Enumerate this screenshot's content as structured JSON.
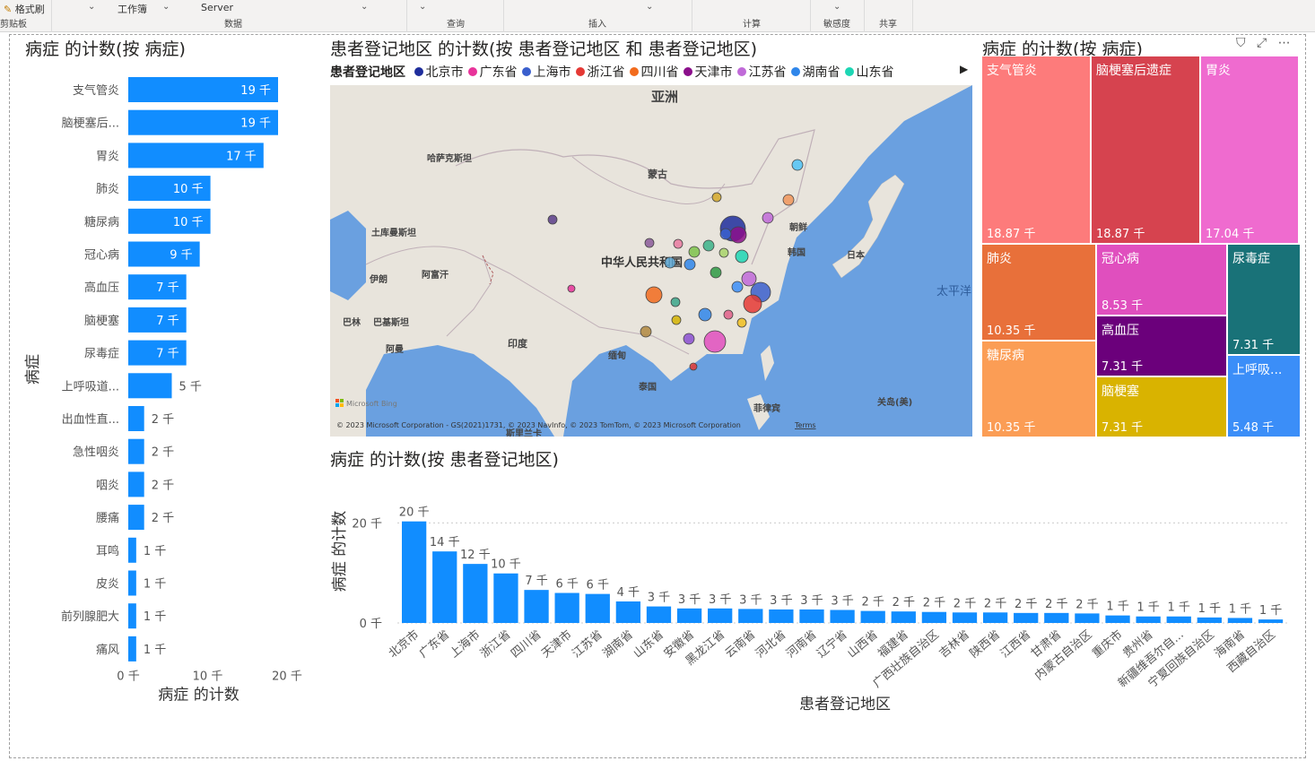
{
  "ribbon": {
    "format_painter": "格式刷",
    "workbench": "工作簿",
    "server": "Server",
    "clipboard": "剪贴板",
    "groups": [
      "数据",
      "查询",
      "插入",
      "计算",
      "敏感度",
      "共享"
    ]
  },
  "bar_visual": {
    "title": "病症 的计数(按 病症)",
    "ylabel": "病症",
    "xlabel": "病症 的计数"
  },
  "map_visual": {
    "title": "患者登记地区 的计数(按 患者登记地区 和 患者登记地区)",
    "legend_title": "患者登记地区",
    "legend": [
      {
        "name": "北京市",
        "color": "#1f2e9c"
      },
      {
        "name": "广东省",
        "color": "#e8339a"
      },
      {
        "name": "上海市",
        "color": "#3a5fcd"
      },
      {
        "name": "浙江省",
        "color": "#e53935"
      },
      {
        "name": "四川省",
        "color": "#f26b1d"
      },
      {
        "name": "天津市",
        "color": "#8b0f8b"
      },
      {
        "name": "江苏省",
        "color": "#c06ad8"
      },
      {
        "name": "湖南省",
        "color": "#2f86ea"
      },
      {
        "name": "山东省",
        "color": "#1dd6b4"
      }
    ],
    "labels": {
      "asia": "亚洲",
      "kazakh": "哈萨克斯坦",
      "mongolia": "蒙古",
      "turkmen": "土库曼斯坦",
      "china": "中华人民共和国",
      "afghan": "阿富汗",
      "iran": "伊朗",
      "pakistan": "巴基斯坦",
      "oman": "阿曼",
      "bahrain": "巴林",
      "india": "印度",
      "srilanka": "斯里兰卡",
      "myanmar": "缅甸",
      "thailand": "泰国",
      "korea": "韩国",
      "nkorea": "朝鲜",
      "japan": "日本",
      "pacific": "太平洋",
      "philippines": "菲律宾",
      "guam": "关岛(美)",
      "bing": "Microsoft Bing",
      "copyright": "© 2023 Microsoft Corporation - GS(2021)1731, © 2023 NavInfo, © 2023 TomTom, © 2023 Microsoft Corporation",
      "terms": "Terms"
    }
  },
  "treemap_visual": {
    "title": "病症 的计数(按 病症)",
    "cells": [
      {
        "name": "支气管炎",
        "value": "18.87 千",
        "color": "#fd7b7b"
      },
      {
        "name": "脑梗塞后遗症",
        "value": "18.87 千",
        "color": "#d6434f"
      },
      {
        "name": "胃炎",
        "value": "17.04 千",
        "color": "#ef6bcf"
      },
      {
        "name": "肺炎",
        "value": "10.35 千",
        "color": "#e8703a"
      },
      {
        "name": "糖尿病",
        "value": "10.35 千",
        "color": "#fb9d55"
      },
      {
        "name": "冠心病",
        "value": "8.53 千",
        "color": "#e04fbe"
      },
      {
        "name": "高血压",
        "value": "7.31 千",
        "color": "#6b007b"
      },
      {
        "name": "脑梗塞",
        "value": "7.31 千",
        "color": "#d9b300"
      },
      {
        "name": "尿毒症",
        "value": "7.31 千",
        "color": "#197278"
      },
      {
        "name": "上呼吸...",
        "value": "5.48 千",
        "color": "#3b8ef8"
      }
    ]
  },
  "column_visual": {
    "title": "病症 的计数(按 患者登记地区)",
    "ylabel": "病症 的计数",
    "xlabel": "患者登记地区"
  },
  "chart_data": [
    {
      "type": "bar",
      "orientation": "horizontal",
      "title": "病症 的计数(按 病症)",
      "xlabel": "病症 的计数",
      "ylabel": "病症",
      "xlim": [
        0,
        20000
      ],
      "xticks": [
        "0 千",
        "10 千",
        "20 千"
      ],
      "color": "#118dff",
      "categories": [
        "支气管炎",
        "脑梗塞后...",
        "胃炎",
        "肺炎",
        "糖尿病",
        "冠心病",
        "高血压",
        "脑梗塞",
        "尿毒症",
        "上呼吸道...",
        "出血性直...",
        "急性咽炎",
        "咽炎",
        "腰痛",
        "耳鸣",
        "皮炎",
        "前列腺肥大",
        "痛风"
      ],
      "values": [
        18870,
        18870,
        17040,
        10350,
        10350,
        9000,
        7310,
        7310,
        7310,
        5480,
        2000,
        2000,
        2000,
        2000,
        1000,
        1000,
        1000,
        1000
      ],
      "data_labels": [
        "19 千",
        "19 千",
        "17 千",
        "10 千",
        "10 千",
        "9 千",
        "7 千",
        "7 千",
        "7 千",
        "5 千",
        "2 千",
        "2 千",
        "2 千",
        "2 千",
        "1 千",
        "1 千",
        "1 千",
        "1 千"
      ]
    },
    {
      "type": "bar",
      "title": "病症 的计数(按 患者登记地区)",
      "xlabel": "患者登记地区",
      "ylabel": "病症 的计数",
      "ylim": [
        0,
        22000
      ],
      "yticks": [
        "0 千",
        "20 千"
      ],
      "grid": true,
      "color": "#118dff",
      "categories": [
        "北京市",
        "广东省",
        "上海市",
        "浙江省",
        "四川省",
        "天津市",
        "江苏省",
        "湖南省",
        "山东省",
        "安徽省",
        "黑龙江省",
        "云南省",
        "河北省",
        "河南省",
        "辽宁省",
        "山西省",
        "福建省",
        "广西壮族自治区",
        "吉林省",
        "陕西省",
        "江西省",
        "甘肃省",
        "内蒙古自治区",
        "重庆市",
        "贵州省",
        "新疆维吾尔自...",
        "宁夏回族自治区",
        "海南省",
        "西藏自治区"
      ],
      "values": [
        20300,
        14300,
        11800,
        9900,
        6600,
        6000,
        5800,
        4300,
        3300,
        2900,
        2900,
        2800,
        2700,
        2700,
        2600,
        2400,
        2300,
        2200,
        2100,
        2100,
        2000,
        2000,
        1900,
        1500,
        1300,
        1300,
        1100,
        1000,
        700
      ],
      "data_labels": [
        "20 千",
        "14 千",
        "12 千",
        "10 千",
        "7 千",
        "6 千",
        "6 千",
        "4 千",
        "3 千",
        "3 千",
        "3 千",
        "3 千",
        "3 千",
        "3 千",
        "3 千",
        "2 千",
        "2 千",
        "2 千",
        "2 千",
        "2 千",
        "2 千",
        "2 千",
        "2 千",
        "1 千",
        "1 千",
        "1 千",
        "1 千",
        "1 千",
        "1 千"
      ]
    }
  ]
}
